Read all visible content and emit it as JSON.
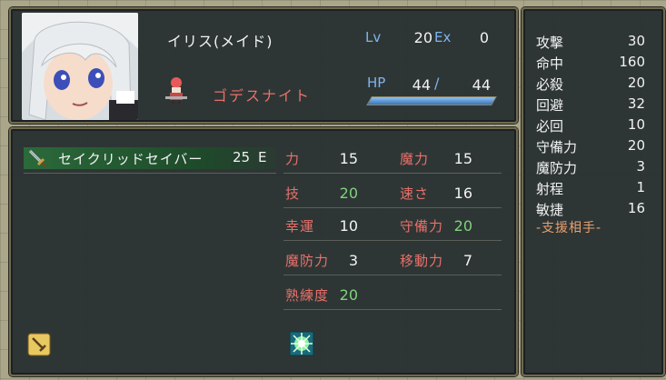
{
  "unit": {
    "name": "イリス(メイド)",
    "class": "ゴデスナイト",
    "lv_label": "Lv",
    "lv": "20",
    "ex_label": "Ex",
    "ex": "0",
    "hp_label": "HP",
    "hp_current": "44",
    "hp_separator": "/",
    "hp_max": "44",
    "hp_fraction": 1.0
  },
  "weapon": {
    "name": "セイクリッドセイバー",
    "uses": "25",
    "rank": "E",
    "icon": "sword-icon"
  },
  "stats": [
    {
      "label": "力",
      "value": "15",
      "green": false
    },
    {
      "label": "魔力",
      "value": "15",
      "green": false
    },
    {
      "label": "技",
      "value": "20",
      "green": true
    },
    {
      "label": "速さ",
      "value": "16",
      "green": false
    },
    {
      "label": "幸運",
      "value": "10",
      "green": false
    },
    {
      "label": "守備力",
      "value": "20",
      "green": true
    },
    {
      "label": "魔防力",
      "value": "3",
      "green": false
    },
    {
      "label": "移動力",
      "value": "7",
      "green": false
    },
    {
      "label": "熟練度",
      "value": "20",
      "green": true
    }
  ],
  "combat": [
    {
      "label": "攻撃",
      "value": "30"
    },
    {
      "label": "命中",
      "value": "160"
    },
    {
      "label": "必殺",
      "value": "20"
    },
    {
      "label": "回避",
      "value": "32"
    },
    {
      "label": "必回",
      "value": "10"
    },
    {
      "label": "守備力",
      "value": "20"
    },
    {
      "label": "魔防力",
      "value": "3"
    },
    {
      "label": "射程",
      "value": "1"
    },
    {
      "label": "敏捷",
      "value": "16"
    }
  ],
  "support_label": "-支援相手-",
  "icons": {
    "equip": "equipped-item-icon",
    "skill": "skill-icon"
  },
  "colors": {
    "label_red": "#e8706a",
    "label_blue": "#7fb4ee",
    "value_green": "#7ed47a",
    "panel_bg": "#242c2e",
    "frame": "#6f6a50"
  }
}
